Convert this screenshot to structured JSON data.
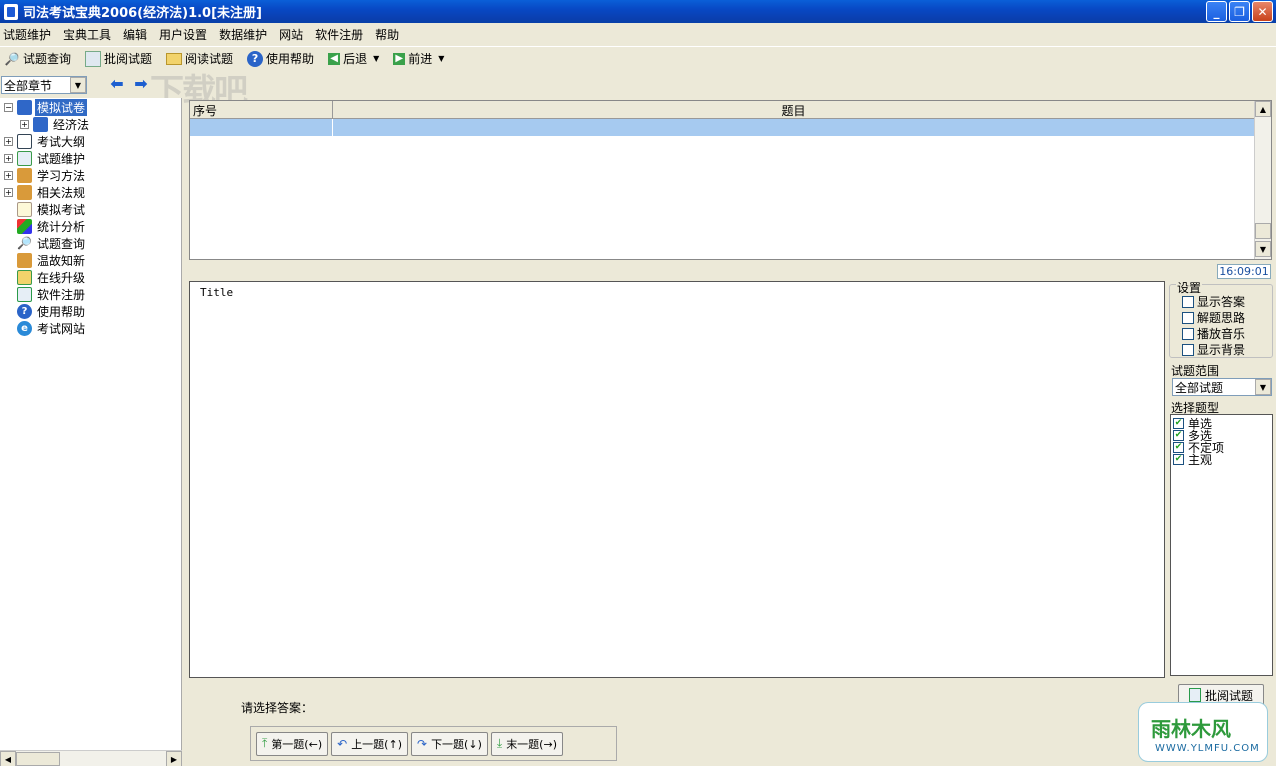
{
  "window": {
    "title": "司法考试宝典2006(经济法)1.0[未注册]"
  },
  "menu": [
    "试题维护",
    "宝典工具",
    "编辑",
    "用户设置",
    "数据维护",
    "网站",
    "软件注册",
    "帮助"
  ],
  "toolbar": {
    "query": "试题查询",
    "grade": "批阅试题",
    "read": "阅读试题",
    "help": "使用帮助",
    "back": "后退",
    "forward": "前进"
  },
  "chapter_select": {
    "value": "全部章节"
  },
  "watermark": "下载吧",
  "tree": {
    "root": "模拟试卷",
    "child": "经济法",
    "items": [
      "考试大纲",
      "试题维护",
      "学习方法",
      "相关法规",
      "模拟考试",
      "统计分析",
      "试题查询",
      "温故知新",
      "在线升级",
      "软件注册",
      "使用帮助",
      "考试网站"
    ]
  },
  "grid": {
    "col_index": "序号",
    "col_title": "题目"
  },
  "timer": "16:09:01",
  "question": {
    "text": "Title"
  },
  "settings": {
    "legend": "设置",
    "options": [
      {
        "label": "显示答案",
        "checked": false
      },
      {
        "label": "解题思路",
        "checked": false
      },
      {
        "label": "播放音乐",
        "checked": false
      },
      {
        "label": "显示背景",
        "checked": false
      }
    ]
  },
  "range": {
    "label": "试题范围",
    "value": "全部试题"
  },
  "types": {
    "label": "选择题型",
    "items": [
      {
        "label": "单选",
        "checked": true
      },
      {
        "label": "多选",
        "checked": true
      },
      {
        "label": "不定项",
        "checked": true
      },
      {
        "label": "主观",
        "checked": true
      }
    ]
  },
  "grade_button": "批阅试题",
  "answer_prompt": "请选择答案：",
  "nav": {
    "first": "第一题(←)",
    "prev": "上一题(↑)",
    "next": "下一题(↓)",
    "last": "末一题(→)"
  },
  "logo": {
    "name": "雨林木风",
    "url": "WWW.YLMFU.COM"
  },
  "colors": {
    "titlebar": "#0848c4",
    "selection": "#316ac5",
    "grid_row": "#a6caf0"
  }
}
